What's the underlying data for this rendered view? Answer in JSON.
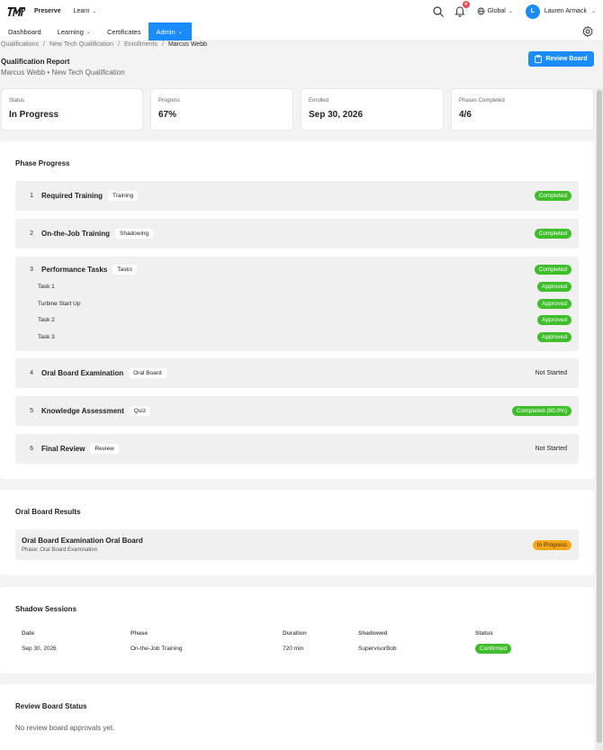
{
  "header": {
    "brand": "Preserve",
    "learn_menu": "Learn",
    "notifications_count": "4",
    "region": "Global",
    "user_initial": "L",
    "user_name": "Lauren Armack"
  },
  "nav": {
    "items": [
      {
        "label": "Dashboard"
      },
      {
        "label": "Learning"
      },
      {
        "label": "Certificates"
      },
      {
        "label": "Admin"
      }
    ],
    "active": "Admin"
  },
  "breadcrumb": [
    "Qualifications",
    "New Tech Qualification",
    "Enrollments",
    "Marcus Webb"
  ],
  "page": {
    "title": "Qualification Report",
    "subtitle": "Marcus Webb • New Tech Qualification",
    "review_button": "Review Board"
  },
  "stats": [
    {
      "label": "Status",
      "value": "In Progress"
    },
    {
      "label": "Progress",
      "value": "67%"
    },
    {
      "label": "Enrolled",
      "value": "Sep 30, 2026"
    },
    {
      "label": "Phases Completed",
      "value": "4/6"
    }
  ],
  "phase_progress": {
    "title": "Phase Progress",
    "phases": [
      {
        "num": "1",
        "name": "Required Training",
        "tag": "Training",
        "status": "Completed"
      },
      {
        "num": "2",
        "name": "On-the-Job Training",
        "tag": "Shadowing",
        "status": "Completed"
      },
      {
        "num": "3",
        "name": "Performance Tasks",
        "tag": "Tasks",
        "status": "Completed",
        "tasks": [
          {
            "name": "Task 1",
            "status": "Approved"
          },
          {
            "name": "Turbine Start Up",
            "status": "Approved"
          },
          {
            "name": "Task 2",
            "status": "Approved"
          },
          {
            "name": "Task 3",
            "status": "Approved"
          }
        ]
      },
      {
        "num": "4",
        "name": "Oral Board Examination",
        "tag": "Oral Board",
        "status": "Not Started"
      },
      {
        "num": "5",
        "name": "Knowledge Assessment",
        "tag": "Quiz",
        "status": "Completed (80.0%)"
      },
      {
        "num": "6",
        "name": "Final Review",
        "tag": "Review",
        "status": "Not Started"
      }
    ]
  },
  "oral_board": {
    "title": "Oral Board Results",
    "item": {
      "name": "Oral Board Examination Oral Board",
      "phase": "Phase: Oral Board Examination",
      "status": "In Progress"
    }
  },
  "shadow_sessions": {
    "title": "Shadow Sessions",
    "columns": [
      "Date",
      "Phase",
      "Duration",
      "Shadowed",
      "Status"
    ],
    "rows": [
      {
        "date": "Sep 30, 2026",
        "phase": "On-the-Job Training",
        "duration": "720 min",
        "shadowed": "SupervisorBob",
        "status": "Confirmed"
      }
    ]
  },
  "review_board_status": {
    "title": "Review Board Status",
    "empty": "No review board approvals yet."
  },
  "colors": {
    "accent": "#1a8cff",
    "success": "#3fbd2b",
    "warning": "#f3a81c",
    "notification": "#e5484d"
  }
}
